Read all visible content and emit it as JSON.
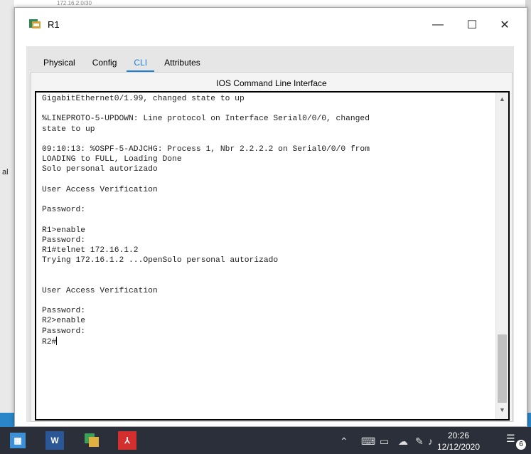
{
  "background": {
    "left_fragment": "al",
    "top_fragment": "172.16.2.0/30"
  },
  "window": {
    "title": "R1",
    "minimize_glyph": "—",
    "maximize_glyph": "☐",
    "close_glyph": "✕"
  },
  "tabs": [
    {
      "label": "Physical",
      "active": false
    },
    {
      "label": "Config",
      "active": false
    },
    {
      "label": "CLI",
      "active": true
    },
    {
      "label": "Attributes",
      "active": false
    }
  ],
  "cli": {
    "heading": "IOS Command Line Interface",
    "lines": [
      "GigabitEthernet0/1.99, changed state to up",
      "",
      "%LINEPROTO-5-UPDOWN: Line protocol on Interface Serial0/0/0, changed",
      "state to up",
      "",
      "09:10:13: %OSPF-5-ADJCHG: Process 1, Nbr 2.2.2.2 on Serial0/0/0 from",
      "LOADING to FULL, Loading Done",
      "Solo personal autorizado",
      "",
      "User Access Verification",
      "",
      "Password:",
      "",
      "R1>enable",
      "Password:",
      "R1#telnet 172.16.1.2",
      "Trying 172.16.1.2 ...OpenSolo personal autorizado",
      "",
      "",
      "User Access Verification",
      "",
      "Password:",
      "R2>enable",
      "Password:"
    ],
    "prompt": "R2#"
  },
  "taskbar": {
    "word_label": "W",
    "pdf_label": "⅄",
    "time": "20:26",
    "date": "12/12/2020",
    "notification_count": "6",
    "tray_icons": [
      "chevron-up-icon",
      "meet-now-icon",
      "network-icon",
      "onedrive-icon",
      "pen-icon",
      "volume-icon"
    ]
  }
}
